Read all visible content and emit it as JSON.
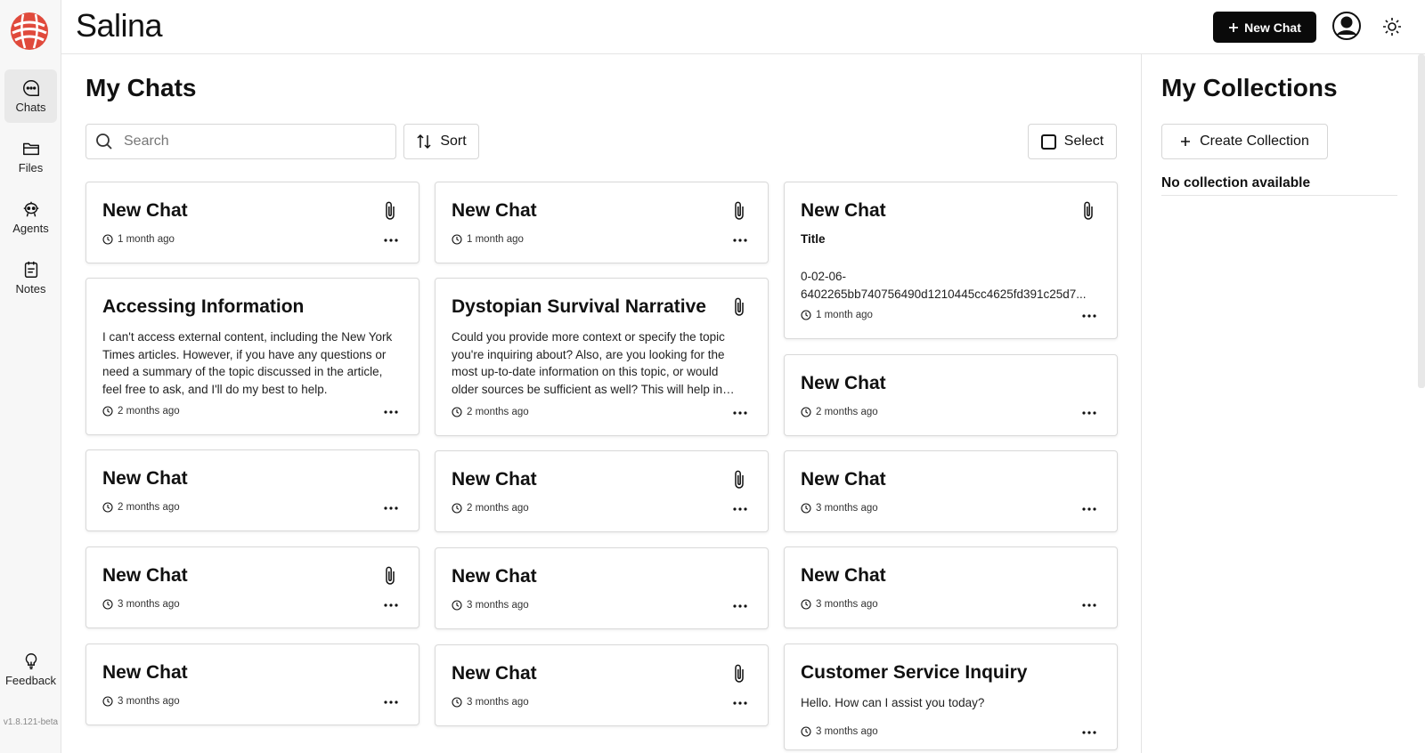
{
  "app": {
    "brand": "Salina",
    "version": "v1.8.121-beta",
    "new_chat_label": "New Chat"
  },
  "sidebar": {
    "items": [
      {
        "label": "Chats",
        "icon": "chat-bubble-icon",
        "active": true
      },
      {
        "label": "Files",
        "icon": "folder-icon",
        "active": false
      },
      {
        "label": "Agents",
        "icon": "agent-icon",
        "active": false
      },
      {
        "label": "Notes",
        "icon": "notes-icon",
        "active": false
      }
    ],
    "feedback_label": "Feedback"
  },
  "main": {
    "title": "My Chats",
    "search_placeholder": "Search",
    "sort_label": "Sort",
    "select_label": "Select"
  },
  "chats": [
    {
      "title": "New Chat",
      "time": "1 month ago",
      "attachment": true
    },
    {
      "title": "Accessing Information",
      "preview": "I can't access external content, including the New York Times articles. However, if you have any questions or need a summary of the topic discussed in the article, feel free to ask, and I'll do my best to help.",
      "time": "2 months ago",
      "attachment": false
    },
    {
      "title": "New Chat",
      "time": "2 months ago",
      "attachment": false
    },
    {
      "title": "New Chat",
      "time": "3 months ago",
      "attachment": true
    },
    {
      "title": "New Chat",
      "time": "3 months ago",
      "attachment": false
    },
    {
      "title": "New Chat",
      "time": "1 month ago",
      "attachment": true
    },
    {
      "title": "Dystopian Survival Narrative",
      "preview": "Could you provide more context or specify the topic you're inquiring about? Also, are you looking for the most up-to-date information on this topic, or would older sources be sufficient as well? This will help in providing the best answer.",
      "time": "2 months ago",
      "attachment": true
    },
    {
      "title": "New Chat",
      "time": "2 months ago",
      "attachment": true
    },
    {
      "title": "New Chat",
      "time": "3 months ago",
      "attachment": false
    },
    {
      "title": "New Chat",
      "time": "3 months ago",
      "attachment": true
    },
    {
      "title": "New Chat",
      "subtitle": "Title",
      "hash_line1": "0-02-06-",
      "hash_line2": "6402265bb740756490d1210445cc4625fd391c25d7...",
      "time": "1 month ago",
      "attachment": true
    },
    {
      "title": "New Chat",
      "time": "2 months ago",
      "attachment": false
    },
    {
      "title": "New Chat",
      "time": "3 months ago",
      "attachment": false
    },
    {
      "title": "New Chat",
      "time": "3 months ago",
      "attachment": false
    },
    {
      "title": "Customer Service Inquiry",
      "preview": "Hello. How can I assist you today?",
      "time": "3 months ago",
      "attachment": false
    }
  ],
  "collections": {
    "title": "My Collections",
    "create_label": "Create Collection",
    "empty_text": "No collection available"
  }
}
